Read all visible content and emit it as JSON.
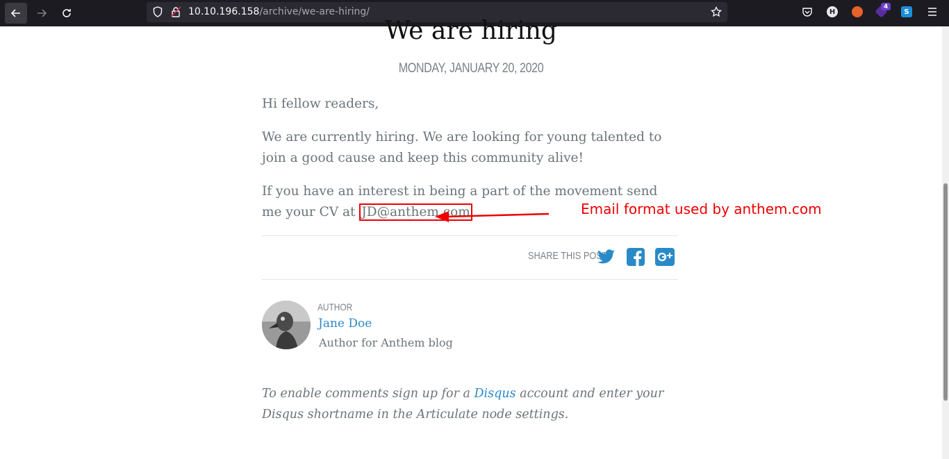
{
  "browser": {
    "url_host": "10.10.196.158",
    "url_path": "/archive/we-are-hiring/",
    "extension_badge_count": "4",
    "profile_initial": "H",
    "ext_s_label": "S"
  },
  "post": {
    "title": "We are hiring",
    "date": "MONDAY, JANUARY 20, 2020",
    "greeting": "Hi fellow readers,",
    "paragraph1": "We are currently hiring. We are looking for young talented to join a good cause and keep this community alive!",
    "paragraph2_prefix": "If you have an interest in being a part of the movement send me your CV at ",
    "email": "JD@anthem.com"
  },
  "share": {
    "label": "SHARE THIS POST"
  },
  "author": {
    "label": "AUTHOR",
    "name": "Jane Doe",
    "bio": "Author for Anthem blog"
  },
  "comments": {
    "prefix": "To enable comments sign up for a ",
    "link": "Disqus",
    "suffix": " account and enter your Disqus shortname in the Articulate node settings."
  },
  "annotation": {
    "text": "Email format used by anthem.com"
  },
  "colors": {
    "annotation": "#e00000",
    "link": "#2a8ac8",
    "toolbar_bg": "#1c1b22"
  }
}
